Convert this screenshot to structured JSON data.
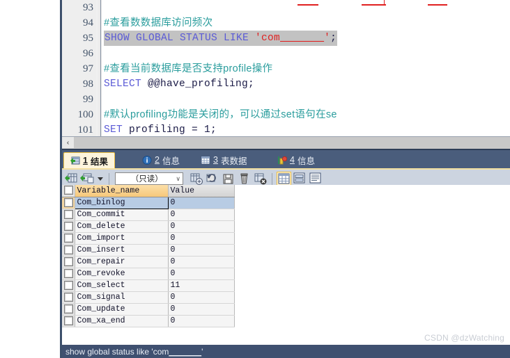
{
  "editor": {
    "lines": [
      {
        "num": "93",
        "segments": [],
        "selected": false
      },
      {
        "num": "94",
        "segments": [
          {
            "cls": "cmt",
            "text": "#查看数数据库访问频次"
          }
        ],
        "selected": false
      },
      {
        "num": "95",
        "segments": [
          {
            "cls": "kw",
            "text": "SHOW GLOBAL STATUS LIKE "
          },
          {
            "cls": "str",
            "text": "'com"
          },
          {
            "cls": "str und",
            "text": "_______"
          },
          {
            "cls": "str",
            "text": "'"
          },
          {
            "cls": "plain",
            "text": ";"
          }
        ],
        "selected": true
      },
      {
        "num": "96",
        "segments": [],
        "selected": false
      },
      {
        "num": "97",
        "segments": [
          {
            "cls": "cmt",
            "text": "#查看当前数据库是否支持profile操作"
          }
        ],
        "selected": false
      },
      {
        "num": "98",
        "segments": [
          {
            "cls": "kw",
            "text": "SELECT "
          },
          {
            "cls": "plain",
            "text": "@@have_profiling;"
          }
        ],
        "selected": false
      },
      {
        "num": "99",
        "segments": [],
        "selected": false
      },
      {
        "num": "100",
        "segments": [
          {
            "cls": "cmt",
            "text": "#默认profiling功能是关闭的，可以通过set语句在se"
          }
        ],
        "selected": false
      },
      {
        "num": "101",
        "segments": [
          {
            "cls": "kw",
            "text": "SET "
          },
          {
            "cls": "plain",
            "text": "profiling = 1;"
          }
        ],
        "selected": false
      }
    ],
    "scroll_left_arrow": "‹"
  },
  "result_tabs": [
    {
      "index": "1",
      "label": "结果",
      "icon": "result-grid-icon",
      "active": true
    },
    {
      "index": "2",
      "label": "信息",
      "icon": "info-circle-icon",
      "active": false
    },
    {
      "index": "3",
      "label": "表数据",
      "icon": "table-data-icon",
      "active": false
    },
    {
      "index": "4",
      "label": "信息",
      "icon": "profile-info-icon",
      "active": false
    }
  ],
  "toolbar": {
    "mode_value": "（只读）",
    "caret": "∨",
    "buttons": [
      {
        "name": "insert-record-button"
      },
      {
        "name": "duplicate-record-button"
      },
      {
        "name": "record-dropdown-button"
      },
      {
        "name": "add-record-button"
      },
      {
        "name": "refresh-record-button"
      },
      {
        "name": "save-record-button"
      },
      {
        "name": "delete-record-button"
      },
      {
        "name": "cancel-record-button"
      },
      {
        "name": "grid-view-button"
      },
      {
        "name": "form-view-button"
      },
      {
        "name": "text-view-button"
      }
    ]
  },
  "grid": {
    "columns": [
      "Variable_name",
      "Value"
    ],
    "rows": [
      {
        "name": "Com_binlog",
        "value": "0",
        "selected": true
      },
      {
        "name": "Com_commit",
        "value": "0",
        "selected": false
      },
      {
        "name": "Com_delete",
        "value": "0",
        "selected": false
      },
      {
        "name": "Com_import",
        "value": "0",
        "selected": false
      },
      {
        "name": "Com_insert",
        "value": "0",
        "selected": false
      },
      {
        "name": "Com_repair",
        "value": "0",
        "selected": false
      },
      {
        "name": "Com_revoke",
        "value": "0",
        "selected": false
      },
      {
        "name": "Com_select",
        "value": "11",
        "selected": false
      },
      {
        "name": "Com_signal",
        "value": "0",
        "selected": false
      },
      {
        "name": "Com_update",
        "value": "0",
        "selected": false
      },
      {
        "name": "Com_xa_end",
        "value": "0",
        "selected": false
      }
    ]
  },
  "statusbar": {
    "prefix": "show global status like 'com",
    "underscores": "_______",
    "suffix": "'"
  },
  "watermark": "CSDN @dzWatching",
  "colors": {
    "tabbar_bg": "#4a5d7c",
    "toolbar_bg": "#ccd4e0",
    "statusbar_bg": "#3f5070",
    "selection_row": "#b8cce4",
    "active_col_header": "#f6c87a",
    "keyword": "#5a5ad6",
    "comment": "#2a9d9d",
    "string": "#e02020"
  }
}
